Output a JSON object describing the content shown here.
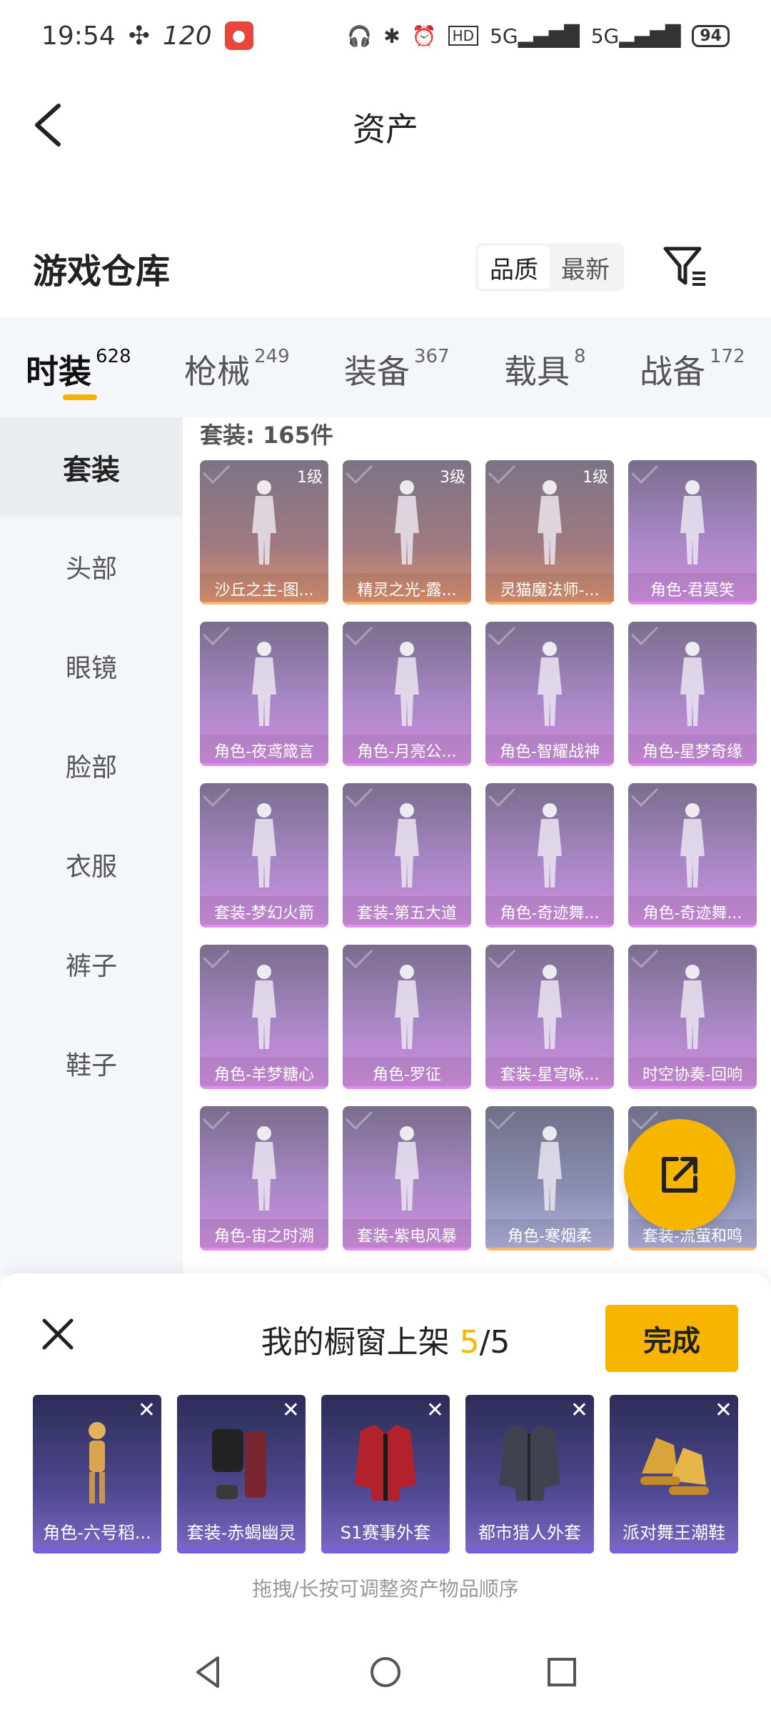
{
  "status": {
    "time": "19:54",
    "refresh": "120",
    "battery": "94",
    "network1": "5G",
    "network2": "5G"
  },
  "header": {
    "title": "资产"
  },
  "warehouse": {
    "title": "游戏仓库",
    "sort": {
      "options": [
        "品质",
        "最新"
      ],
      "active": "品质"
    }
  },
  "categories": [
    {
      "label": "时装",
      "count": "628",
      "active": true
    },
    {
      "label": "枪械",
      "count": "249"
    },
    {
      "label": "装备",
      "count": "367"
    },
    {
      "label": "载具",
      "count": "8"
    },
    {
      "label": "战备",
      "count": "172"
    }
  ],
  "side_menu": [
    "套装",
    "头部",
    "眼镜",
    "脸部",
    "衣服",
    "裤子",
    "鞋子"
  ],
  "content": {
    "set_count": "套装: 165件",
    "items": [
      {
        "name": "沙丘之主-图...",
        "level": "1级",
        "tone": "orange"
      },
      {
        "name": "精灵之光-露...",
        "level": "3级",
        "tone": "orange"
      },
      {
        "name": "灵猫魔法师-...",
        "level": "1级",
        "tone": "orange"
      },
      {
        "name": "角色-君莫笑",
        "tone": "purple"
      },
      {
        "name": "角色-夜鸢箴言",
        "tone": "purple"
      },
      {
        "name": "角色-月亮公...",
        "tone": "purple"
      },
      {
        "name": "角色-智耀战神",
        "tone": "purple"
      },
      {
        "name": "角色-星梦奇缘",
        "tone": "purple"
      },
      {
        "name": "套装-梦幻火箭",
        "tone": "purple"
      },
      {
        "name": "套装-第五大道",
        "tone": "purple"
      },
      {
        "name": "角色-奇迹舞...",
        "tone": "purple"
      },
      {
        "name": "角色-奇迹舞...",
        "tone": "purple"
      },
      {
        "name": "角色-羊梦糖心",
        "tone": "purple"
      },
      {
        "name": "角色-罗征",
        "tone": "purple"
      },
      {
        "name": "套装-星穹咏...",
        "tone": "purple"
      },
      {
        "name": "时空协奏-回响",
        "tone": "purple"
      },
      {
        "name": "角色-宙之时溯",
        "tone": "purple"
      },
      {
        "name": "套装-紫电风暴",
        "tone": "purple"
      },
      {
        "name": "角色-寒烟柔",
        "tone": "slate"
      },
      {
        "name": "套装-流萤和鸣",
        "tone": "slate"
      }
    ]
  },
  "sheet": {
    "title_prefix": "我的橱窗上架 ",
    "count_current": "5",
    "count_total": "/5",
    "done_label": "完成",
    "hint": "拖拽/长按可调整资产物品顺序",
    "items": [
      {
        "name": "角色-六号稻..."
      },
      {
        "name": "套装-赤蝎幽灵"
      },
      {
        "name": "S1赛事外套"
      },
      {
        "name": "都市猎人外套"
      },
      {
        "name": "派对舞王潮鞋"
      }
    ]
  },
  "colors": {
    "accent": "#f5b400",
    "purple_card": "#c48ad9",
    "orange_card": "#e2946f"
  }
}
